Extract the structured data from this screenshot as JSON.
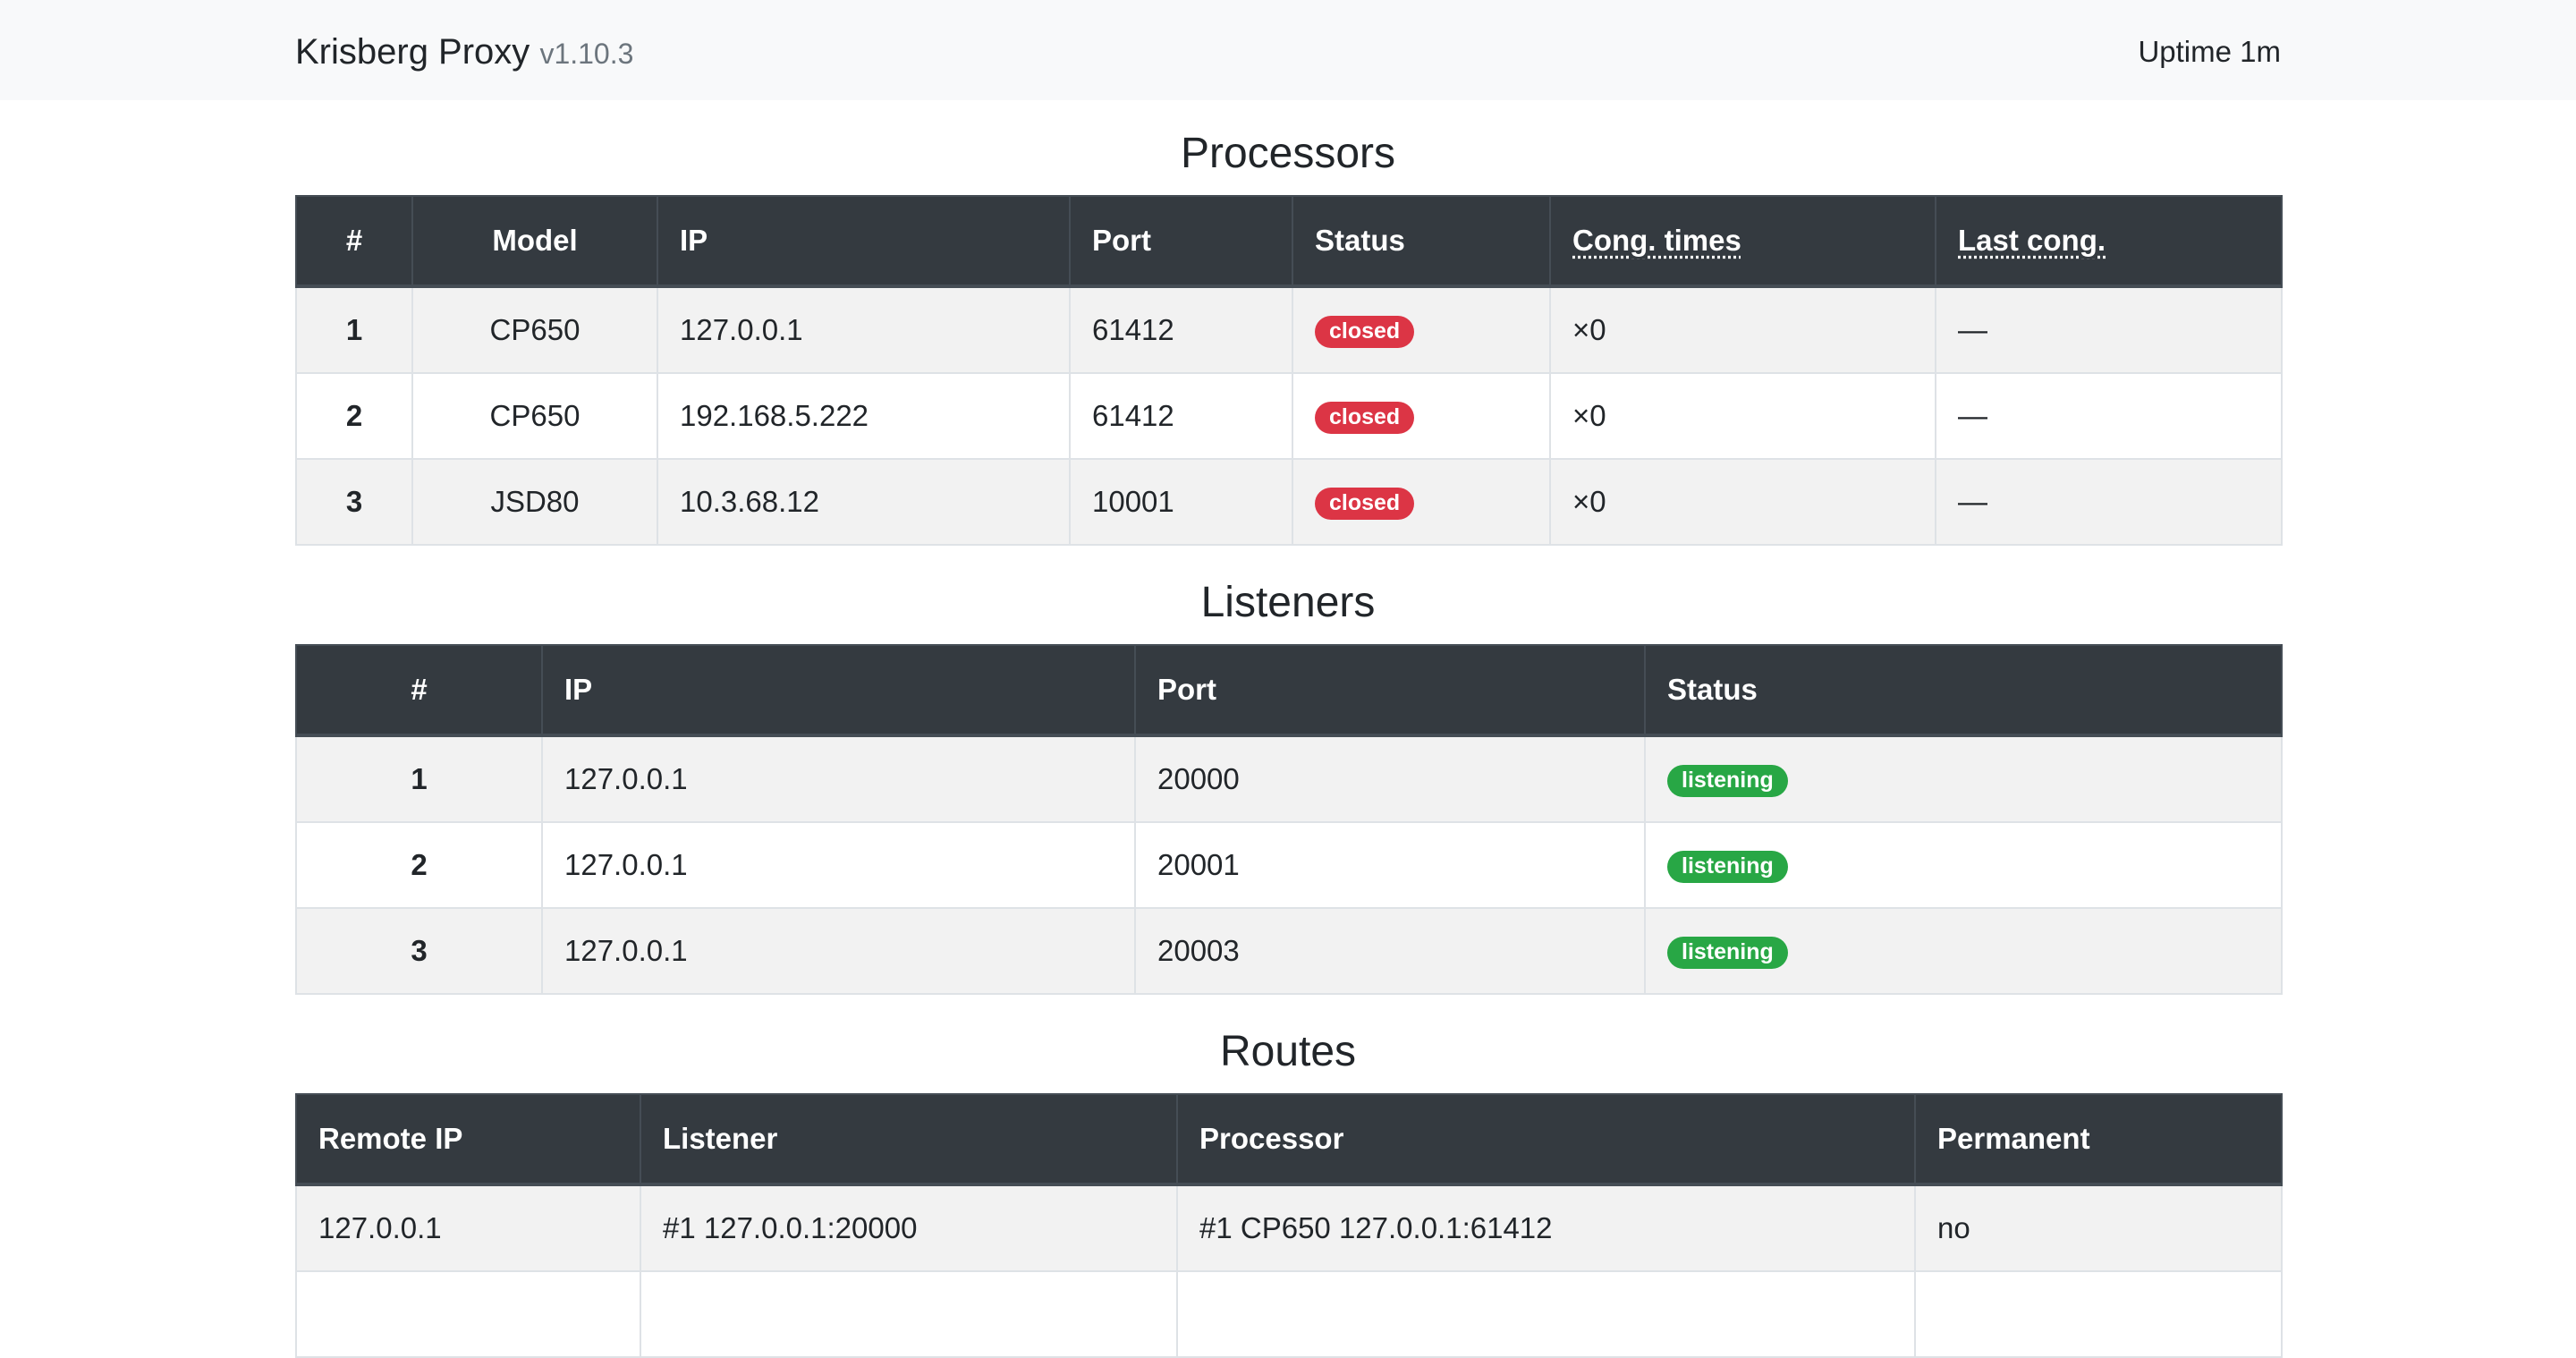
{
  "navbar": {
    "brand": "Krisberg Proxy",
    "version": "v1.10.3",
    "uptime": "Uptime 1m"
  },
  "colors": {
    "navbar_bg": "#f8f9fa",
    "table_header_bg": "#343a40",
    "badge_closed": "#dc3545",
    "badge_listening": "#28a745"
  },
  "processors": {
    "title": "Processors",
    "headers": [
      "#",
      "Model",
      "IP",
      "Port",
      "Status",
      "Cong. times",
      "Last cong."
    ],
    "rows": [
      {
        "num": "1",
        "model": "CP650",
        "ip": "127.0.0.1",
        "port": "61412",
        "status": "closed",
        "cong_times": "×0",
        "last_cong": "—"
      },
      {
        "num": "2",
        "model": "CP650",
        "ip": "192.168.5.222",
        "port": "61412",
        "status": "closed",
        "cong_times": "×0",
        "last_cong": "—"
      },
      {
        "num": "3",
        "model": "JSD80",
        "ip": "10.3.68.12",
        "port": "10001",
        "status": "closed",
        "cong_times": "×0",
        "last_cong": "—"
      }
    ]
  },
  "listeners": {
    "title": "Listeners",
    "headers": [
      "#",
      "IP",
      "Port",
      "Status"
    ],
    "rows": [
      {
        "num": "1",
        "ip": "127.0.0.1",
        "port": "20000",
        "status": "listening"
      },
      {
        "num": "2",
        "ip": "127.0.0.1",
        "port": "20001",
        "status": "listening"
      },
      {
        "num": "3",
        "ip": "127.0.0.1",
        "port": "20003",
        "status": "listening"
      }
    ]
  },
  "routes": {
    "title": "Routes",
    "headers": [
      "Remote IP",
      "Listener",
      "Processor",
      "Permanent"
    ],
    "rows": [
      {
        "remote_ip": "127.0.0.1",
        "listener": "#1 127.0.0.1:20000",
        "processor": "#1 CP650 127.0.0.1:61412",
        "permanent": "no"
      }
    ]
  }
}
